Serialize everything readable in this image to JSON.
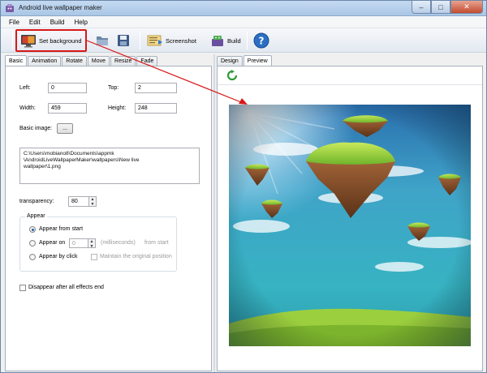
{
  "window": {
    "title": "Android live wallpaper maker"
  },
  "menu": {
    "items": [
      "File",
      "Edit",
      "Build",
      "Help"
    ]
  },
  "toolbar": {
    "set_background": "Set background",
    "screenshot": "Screenshot",
    "build": "Build"
  },
  "left_tabs": [
    "Basic",
    "Animation",
    "Rotate",
    "Move",
    "Resize",
    "Fade"
  ],
  "basic": {
    "left_label": "Left:",
    "left_value": "0",
    "top_label": "Top:",
    "top_value": "2",
    "width_label": "Width:",
    "width_value": "459",
    "height_label": "Height:",
    "height_value": "248",
    "image_label": "Basic image:",
    "browse_label": "...",
    "path_lines": [
      "C:\\Users\\mobiano8\\Documents\\appmk",
      "\\AndroidLiveWallpaperMaker\\wallpapers\\New live",
      "wallpaper\\1.png"
    ],
    "transparency_label": "transparency:",
    "transparency_value": "80",
    "appear": {
      "title": "Appear",
      "from_start": "Appear from start",
      "on": "Appear on",
      "on_value": "0",
      "ms_label": "(milliseconds)",
      "from_start_suffix": "from start",
      "by_click": "Appear by click",
      "maintain": "Maintain the original position"
    },
    "disappear": "Disappear after all effects end"
  },
  "right_tabs": [
    "Design",
    "Preview"
  ],
  "colors": {
    "highlight": "#d81818",
    "accent": "#1f5ea8"
  }
}
